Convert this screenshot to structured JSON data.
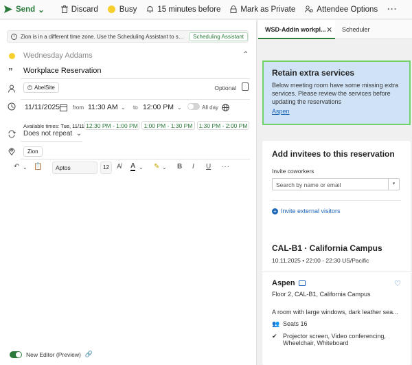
{
  "toolbar": {
    "send": "Send",
    "discard": "Discard",
    "busy": "Busy",
    "reminder": "15 minutes before",
    "mark_private": "Mark as Private",
    "attendee_options": "Attendee Options",
    "more": "···"
  },
  "info_bar": {
    "text": "Zion is in a different time zone. Use the Scheduling Assistant to select times a...",
    "button": "Scheduling Assistant"
  },
  "form": {
    "organizer": "Wednesday Addams",
    "title": "Workplace Reservation",
    "attendee": "AbelSite",
    "optional": "Optional",
    "start_date": "11/11/2025",
    "from_label": "from",
    "start_time": "11:30 AM",
    "to_label": "to",
    "end_time": "12:00 PM",
    "all_day": "All day",
    "available_label": "Available times:",
    "available_date": "Tue, 11/11",
    "slots": [
      "12:30 PM - 1:00 PM",
      "1:00 PM - 1:30 PM",
      "1:30 PM - 2:00 PM"
    ],
    "repeat": "Does not repeat",
    "location": "Zion"
  },
  "format_bar": {
    "font": "Aptos",
    "size": "12"
  },
  "editor_toggle": "New Editor (Preview)",
  "tabs": {
    "active": "WSD-Addin workpl...",
    "other": "Scheduler"
  },
  "alert": {
    "title": "Retain extra services",
    "body": "Below meeting room have some missing extra services. Please review the services before updating the reservations",
    "link": "Aspen"
  },
  "invite": {
    "title": "Add invitees to this reservation",
    "label": "Invite coworkers",
    "placeholder": "Search by name or email",
    "external": "Invite external visitors"
  },
  "room": {
    "header": "CAL-B1 · California Campus",
    "when": "10.11.2025 • 22:00 - 22:30 US/Pacific",
    "name": "Aspen",
    "floor": "Floor 2, CAL-B1, California Campus",
    "description": "A room with large windows, dark leather sea...",
    "seats": "Seats 16",
    "equipment": "Projector screen, Video conferencing, Wheelchair, Whiteboard"
  },
  "colors": {
    "accent_green": "#2b7a3a",
    "alert_bg": "#cfe2f6",
    "alert_border": "#6fd36a",
    "link_blue": "#1c65b8",
    "busy_yellow": "#f7cf2c"
  }
}
